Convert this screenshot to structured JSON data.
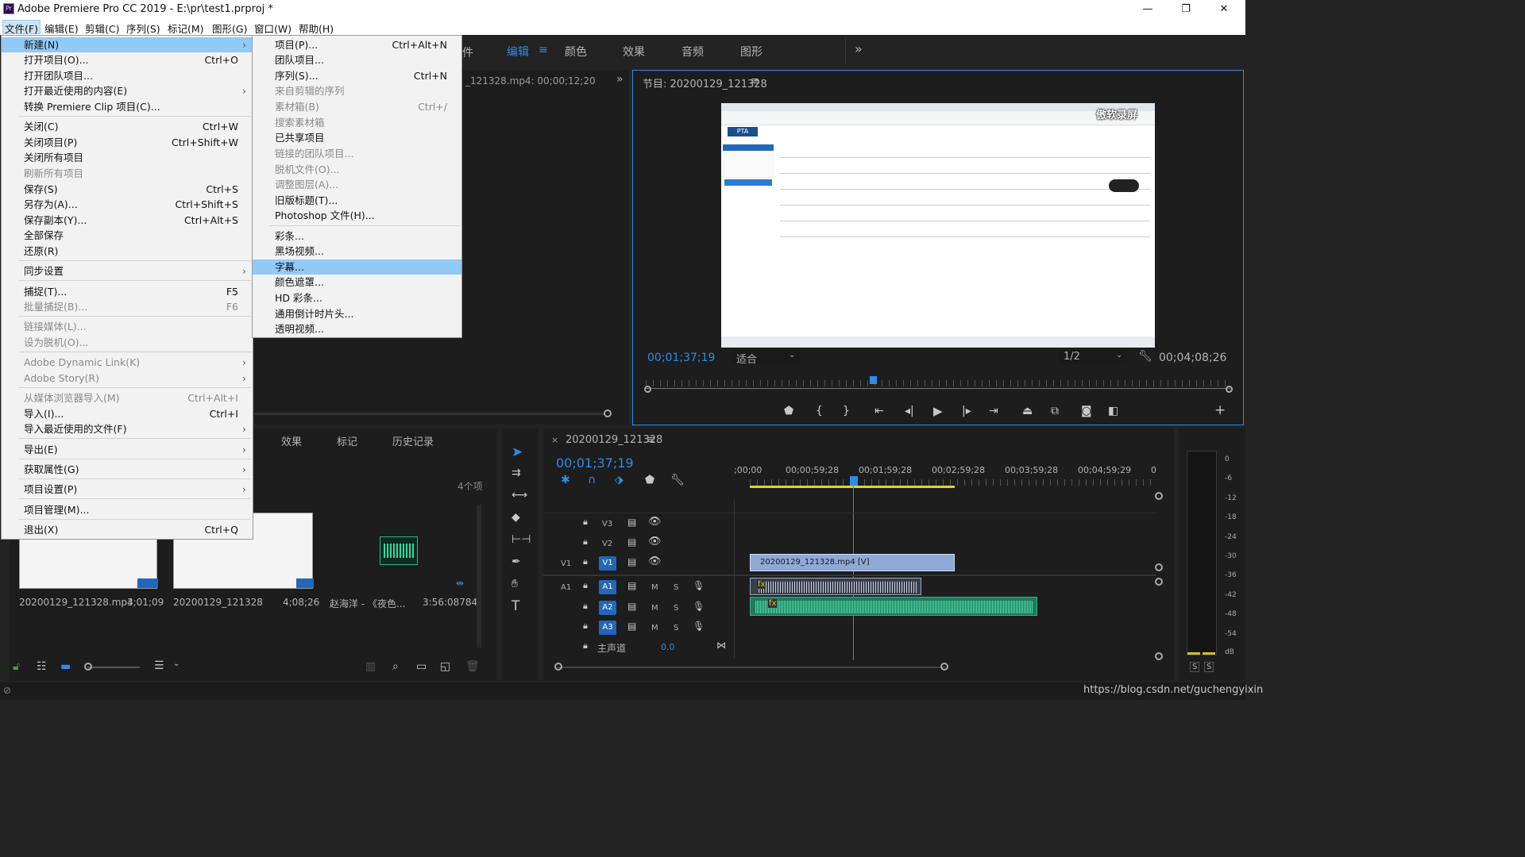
{
  "app": {
    "title": "Adobe Premiere Pro CC 2019 - E:\\pr\\test1.prproj *",
    "icon_text": "Pr",
    "win_min": "—",
    "win_restore": "❐",
    "win_close": "✕"
  },
  "menubar": [
    "文件(F)",
    "编辑(E)",
    "剪辑(C)",
    "序列(S)",
    "标记(M)",
    "图形(G)",
    "窗口(W)",
    "帮助(H)"
  ],
  "workspaces": {
    "prev": "件",
    "edit": "编辑",
    "color": "颜色",
    "effects": "效果",
    "audio": "音频",
    "graphics": "图形",
    "more": "»"
  },
  "source": {
    "label": "_121328.mp4: 00;00;12;20"
  },
  "program": {
    "title": "节目: 20200129_121328",
    "timecode_left": "00;01;37;19",
    "fit": "适合",
    "res": "1/2",
    "timecode_right": "00;04;08;26",
    "watermark": "傲软录屏"
  },
  "file_menu": [
    {
      "label": "新建(N)",
      "arrow": "›",
      "hl": true
    },
    {
      "label": "打开项目(O)...",
      "sc": "Ctrl+O"
    },
    {
      "label": "打开团队项目..."
    },
    {
      "label": "打开最近使用的内容(E)",
      "arrow": "›"
    },
    {
      "label": "转换 Premiere Clip 项目(C)..."
    },
    {
      "label": "关闭(C)",
      "sc": "Ctrl+W"
    },
    {
      "label": "关闭项目(P)",
      "sc": "Ctrl+Shift+W"
    },
    {
      "label": "关闭所有项目"
    },
    {
      "label": "刷新所有项目",
      "dis": true
    },
    {
      "label": "保存(S)",
      "sc": "Ctrl+S"
    },
    {
      "label": "另存为(A)...",
      "sc": "Ctrl+Shift+S"
    },
    {
      "label": "保存副本(Y)...",
      "sc": "Ctrl+Alt+S"
    },
    {
      "label": "全部保存"
    },
    {
      "label": "还原(R)"
    },
    {
      "label": "同步设置",
      "arrow": "›"
    },
    {
      "label": "捕捉(T)...",
      "sc": "F5"
    },
    {
      "label": "批量捕捉(B)...",
      "sc": "F6",
      "dis": true
    },
    {
      "label": "链接媒体(L)...",
      "dis": true
    },
    {
      "label": "设为脱机(O)...",
      "dis": true
    },
    {
      "label": "Adobe Dynamic Link(K)",
      "arrow": "›",
      "dis": true
    },
    {
      "label": "Adobe Story(R)",
      "arrow": "›",
      "dis": true
    },
    {
      "label": "从媒体浏览器导入(M)",
      "sc": "Ctrl+Alt+I",
      "dis": true
    },
    {
      "label": "导入(I)...",
      "sc": "Ctrl+I"
    },
    {
      "label": "导入最近使用的文件(F)",
      "arrow": "›"
    },
    {
      "label": "导出(E)",
      "arrow": "›"
    },
    {
      "label": "获取属性(G)",
      "arrow": "›"
    },
    {
      "label": "项目设置(P)",
      "arrow": "›"
    },
    {
      "label": "项目管理(M)..."
    },
    {
      "label": "退出(X)",
      "sc": "Ctrl+Q"
    }
  ],
  "new_menu": [
    {
      "label": "项目(P)...",
      "sc": "Ctrl+Alt+N"
    },
    {
      "label": "团队项目..."
    },
    {
      "label": "序列(S)...",
      "sc": "Ctrl+N"
    },
    {
      "label": "来自剪辑的序列",
      "dis": true
    },
    {
      "label": "素材箱(B)",
      "sc": "Ctrl+/",
      "dis": true
    },
    {
      "label": "搜索素材箱",
      "dis": true
    },
    {
      "label": "已共享项目"
    },
    {
      "label": "链接的团队项目...",
      "dis": true
    },
    {
      "label": "脱机文件(O)...",
      "dis": true
    },
    {
      "label": "调整图层(A)...",
      "dis": true
    },
    {
      "label": "旧版标题(T)..."
    },
    {
      "label": "Photoshop 文件(H)..."
    },
    {
      "label": "彩条..."
    },
    {
      "label": "黑场视频..."
    },
    {
      "label": "字幕...",
      "hl": true
    },
    {
      "label": "颜色遮罩..."
    },
    {
      "label": "HD 彩条..."
    },
    {
      "label": "通用倒计时片头..."
    },
    {
      "label": "透明视频..."
    }
  ],
  "project": {
    "tabs": [
      "效果",
      "标记",
      "历史记录"
    ],
    "count": "4个项",
    "items": [
      {
        "name": "20200129_121328.mp4",
        "dur": "3;01;09"
      },
      {
        "name": "20200129_121328",
        "dur": "4;08;26"
      },
      {
        "name": "赵海洋 - 《夜色...",
        "dur": "3:56:08784"
      }
    ]
  },
  "timeline": {
    "title": "20200129_121328",
    "timecode": "00;01;37;19",
    "ruler": [
      ";00;00",
      "00;00;59;28",
      "00;01;59;28",
      "00;02;59;28",
      "00;03;59;28",
      "00;04;59;29",
      "0"
    ],
    "tracks": {
      "v3": "V3",
      "v2": "V2",
      "v1_src": "V1",
      "v1": "V1",
      "a1_src": "A1",
      "a1": "A1",
      "a2": "A2",
      "a3": "A3",
      "m": "M",
      "s": "S",
      "master": "主声道",
      "master_val": "0.0"
    },
    "clip_video": "20200129_121328.mp4 [V]",
    "fx": "fx"
  },
  "meter": {
    "labels": [
      "0",
      "-6",
      "-12",
      "-18",
      "-24",
      "-30",
      "-36",
      "-42",
      "-48",
      "-54",
      "dB"
    ],
    "solo": "S"
  },
  "footer": {
    "url": "https://blog.csdn.net/guchengyixin"
  },
  "colors": {
    "accent": "#2d8ceb",
    "video_clip": "#8fa9d6",
    "audio_clip": "#2bb58a",
    "highlight": "#91c9f7"
  }
}
